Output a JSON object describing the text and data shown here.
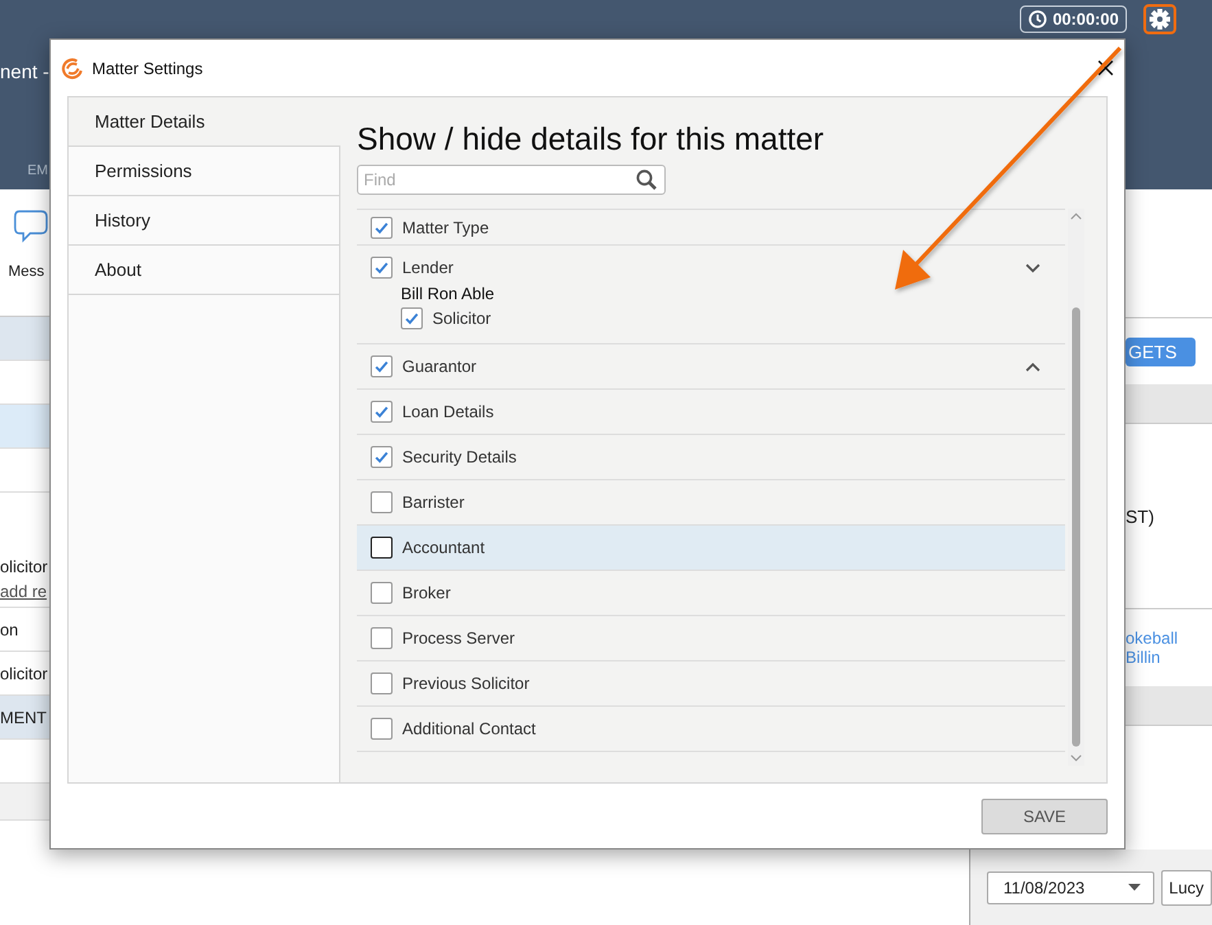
{
  "app": {
    "header_title": "nent -",
    "header_tab": "EM",
    "toolbar_label": "Mess",
    "timer": "00:00:00",
    "left_rows": [
      {
        "kind": "band",
        "text": ""
      },
      {
        "kind": "plain",
        "text": ""
      },
      {
        "kind": "selected",
        "text": ""
      },
      {
        "kind": "plain",
        "text": ""
      },
      {
        "kind": "tall",
        "text": "olicitor",
        "link": "add re"
      },
      {
        "kind": "plain",
        "text": "on"
      },
      {
        "kind": "plain",
        "text": "olicitor"
      },
      {
        "kind": "band",
        "text": "MENT"
      },
      {
        "kind": "plain",
        "text": ""
      },
      {
        "kind": "grey",
        "text": ""
      }
    ],
    "right_button": "GETS",
    "right_text": "ST)",
    "right_link": "okeball Billin",
    "date": "11/08/2023",
    "user": "Lucy"
  },
  "dialog": {
    "title": "Matter Settings",
    "nav": [
      {
        "label": "Matter Details",
        "selected": true
      },
      {
        "label": "Permissions",
        "selected": false
      },
      {
        "label": "History",
        "selected": false
      },
      {
        "label": "About",
        "selected": false
      }
    ],
    "heading": "Show / hide details for this matter",
    "search": {
      "placeholder": "Find"
    },
    "items": [
      {
        "label": "Matter Type",
        "checked": true,
        "highlighted": false
      },
      {
        "label": "Lender",
        "checked": true,
        "highlighted": false,
        "expanded": true,
        "children": [
          {
            "name": "Bill Ron Able",
            "roles": [
              {
                "label": "Solicitor",
                "checked": true
              }
            ]
          }
        ]
      },
      {
        "label": "Guarantor",
        "checked": true,
        "highlighted": false,
        "expanded": false
      },
      {
        "label": "Loan Details",
        "checked": true,
        "highlighted": false
      },
      {
        "label": "Security Details",
        "checked": true,
        "highlighted": false
      },
      {
        "label": "Barrister",
        "checked": false,
        "highlighted": false
      },
      {
        "label": "Accountant",
        "checked": false,
        "highlighted": true
      },
      {
        "label": "Broker",
        "checked": false,
        "highlighted": false
      },
      {
        "label": "Process Server",
        "checked": false,
        "highlighted": false
      },
      {
        "label": "Previous Solicitor",
        "checked": false,
        "highlighted": false
      },
      {
        "label": "Additional Contact",
        "checked": false,
        "highlighted": false
      }
    ],
    "save_button": "SAVE"
  }
}
